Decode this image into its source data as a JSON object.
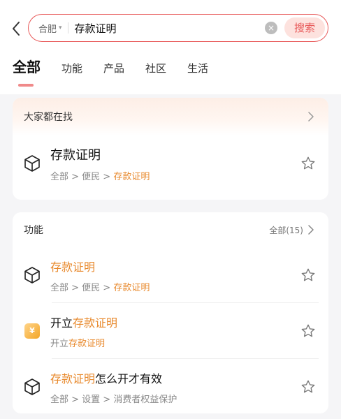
{
  "search": {
    "city": "合肥",
    "query": "存款证明",
    "button_label": "搜索"
  },
  "tabs": [
    {
      "label": "全部",
      "active": true
    },
    {
      "label": "功能"
    },
    {
      "label": "产品"
    },
    {
      "label": "社区"
    },
    {
      "label": "生活"
    }
  ],
  "popular": {
    "title": "大家都在找",
    "item": {
      "title": "存款证明",
      "path_prefix": "全部 > 便民 > ",
      "path_highlight": "存款证明"
    }
  },
  "functions": {
    "title": "功能",
    "more_label": "全部(15)",
    "items": [
      {
        "title_hl": "存款证明",
        "title_rest": "",
        "sub_prefix": "全部 > 便民 > ",
        "sub_hl": "存款证明",
        "icon": "cube-icon"
      },
      {
        "title_pre": "开立",
        "title_hl": "存款证明",
        "sub_prefix": "开立",
        "sub_hl": "存款证明",
        "icon": "yuan-badge-icon",
        "icon_glyph": "¥"
      },
      {
        "title_hl": "存款证明",
        "title_rest": "怎么开才有效",
        "sub_prefix": "全部 > 设置 > 消费者权益保护",
        "sub_hl": "",
        "icon": "cube-icon"
      }
    ]
  },
  "colors": {
    "accent": "#e85a5a",
    "highlight": "#e8892c"
  }
}
